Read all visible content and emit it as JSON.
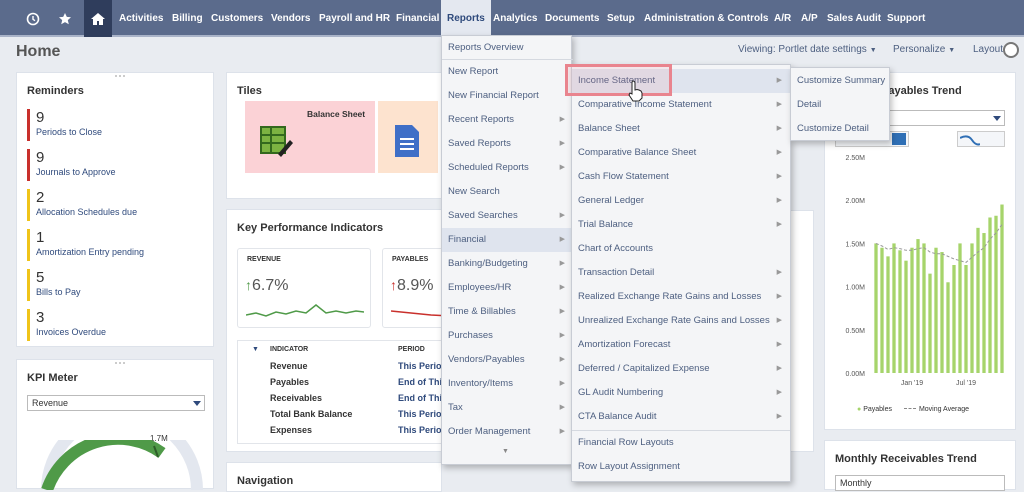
{
  "nav": {
    "items": [
      "Activities",
      "Billing",
      "Customers",
      "Vendors",
      "Payroll and HR",
      "Financial",
      "Reports",
      "Analytics",
      "Documents",
      "Setup",
      "Administration & Controls",
      "A/R",
      "A/P",
      "Sales Audit",
      "Support"
    ]
  },
  "page": {
    "title": "Home",
    "viewing": "Viewing: Portlet date settings",
    "personalize": "Personalize",
    "layout": "Layout"
  },
  "reminders": {
    "title": "Reminders",
    "items": [
      {
        "num": "9",
        "label": "Periods to Close"
      },
      {
        "num": "9",
        "label": "Journals to Approve"
      },
      {
        "num": "2",
        "label": "Allocation Schedules due"
      },
      {
        "num": "1",
        "label": "Amortization Entry pending"
      },
      {
        "num": "5",
        "label": "Bills to Pay"
      },
      {
        "num": "3",
        "label": "Invoices Overdue"
      }
    ]
  },
  "kpimeter": {
    "title": "KPI Meter",
    "select": "Revenue",
    "value": "1.7M"
  },
  "tiles": {
    "title": "Tiles",
    "tile1": "Balance Sheet"
  },
  "kpi": {
    "title": "Key Performance Indicators",
    "rev_label": "REVENUE",
    "rev_value": "6.7%",
    "pay_label": "PAYABLES",
    "pay_value": "8.9%",
    "col_indicator": "INDICATOR",
    "col_period": "PERIOD",
    "rows": [
      {
        "name": "Revenue",
        "period": "This Period"
      },
      {
        "name": "Payables",
        "period": "End of This"
      },
      {
        "name": "Receivables",
        "period": "End of This"
      },
      {
        "name": "Total Bank Balance",
        "period": "This Period"
      },
      {
        "name": "Expenses",
        "period": "This Period"
      }
    ]
  },
  "navigation": {
    "title": "Navigation"
  },
  "payables": {
    "title": "Payables Trend",
    "legend1": "Payables",
    "legend2": "Moving Average"
  },
  "receivables": {
    "title": "Monthly Receivables Trend",
    "select": "Monthly"
  },
  "menu_reports": [
    "Reports Overview",
    "New Report",
    "New Financial Report",
    "Recent Reports",
    "Saved Reports",
    "Scheduled Reports",
    "New Search",
    "Saved Searches",
    "Financial",
    "Banking/Budgeting",
    "Employees/HR",
    "Time & Billables",
    "Purchases",
    "Vendors/Payables",
    "Inventory/Items",
    "Tax",
    "Order Management"
  ],
  "menu_financial": [
    "Income Statement",
    "Comparative Income Statement",
    "Balance Sheet",
    "Comparative Balance Sheet",
    "Cash Flow Statement",
    "General Ledger",
    "Trial Balance",
    "Chart of Accounts",
    "Transaction Detail",
    "Realized Exchange Rate Gains and Losses",
    "Unrealized Exchange Rate Gains and Losses",
    "Amortization Forecast",
    "Deferred / Capitalized Expense",
    "GL Audit Numbering",
    "CTA Balance Audit",
    "Financial Row Layouts",
    "Row Layout Assignment"
  ],
  "menu_income": [
    "Customize Summary",
    "Detail",
    "Customize Detail"
  ],
  "colors": {
    "nav": "#5b6b8c",
    "bar": "#a6d46b",
    "danger": "#c9302c",
    "warn": "#f0c419"
  },
  "chart_data": {
    "type": "bar",
    "ytick_labels": [
      "0.00M",
      "0.50M",
      "1.00M",
      "1.50M",
      "2.00M",
      "2.50M"
    ],
    "ylim": [
      0,
      2.5
    ],
    "xtick_labels": [
      "Jan '19",
      "Jul '19"
    ],
    "values": [
      1.5,
      1.45,
      1.35,
      1.5,
      1.42,
      1.3,
      1.45,
      1.55,
      1.5,
      1.15,
      1.45,
      1.4,
      1.05,
      1.25,
      1.5,
      1.25,
      1.5,
      1.68,
      1.62,
      1.8,
      1.82,
      1.95
    ],
    "moving_average": [
      1.5,
      1.47,
      1.43,
      1.45,
      1.44,
      1.42,
      1.42,
      1.44,
      1.45,
      1.4,
      1.38,
      1.38,
      1.35,
      1.32,
      1.3,
      1.28,
      1.34,
      1.4,
      1.45,
      1.55,
      1.62,
      1.72
    ],
    "series": [
      {
        "name": "Payables"
      },
      {
        "name": "Moving Average"
      }
    ],
    "legend": "bottom"
  }
}
